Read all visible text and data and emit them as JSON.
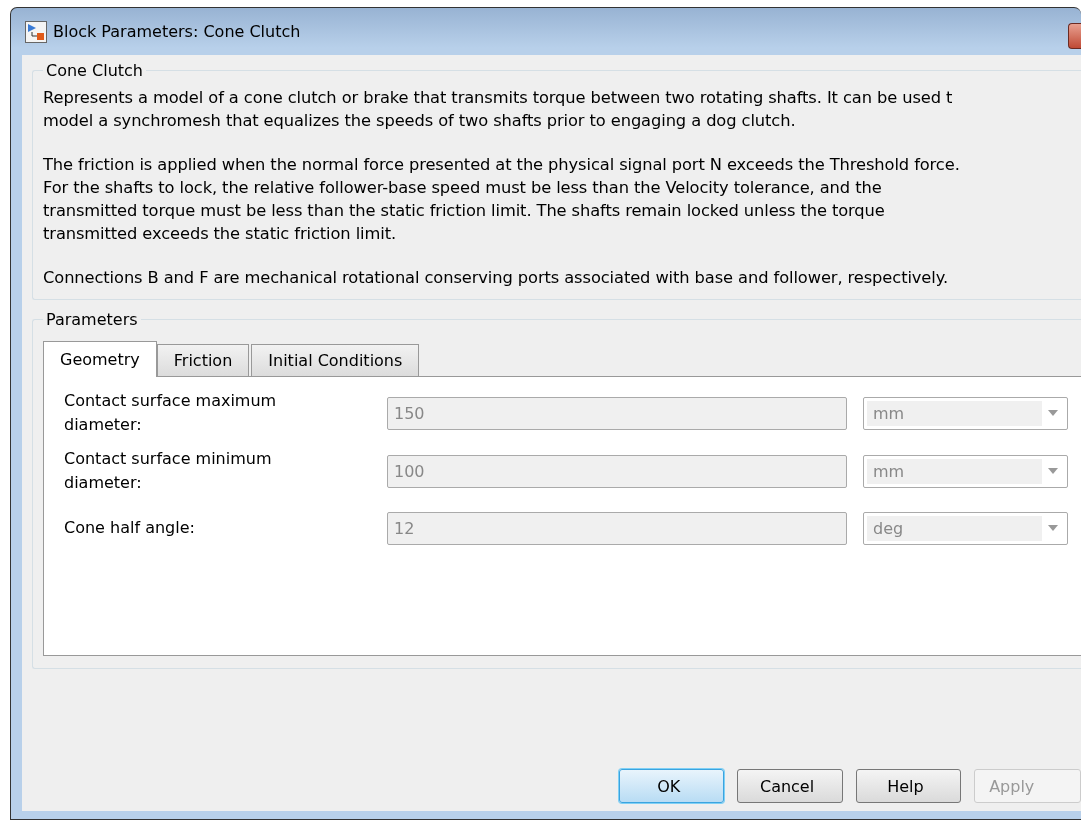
{
  "window": {
    "title": "Block Parameters: Cone Clutch"
  },
  "description": {
    "title": "Cone Clutch",
    "paragraphs": [
      [
        "Represents a model of a cone clutch or brake that transmits torque between two rotating shafts. It can be used t",
        "model a synchromesh that equalizes the speeds of two shafts prior to engaging a dog clutch."
      ],
      [
        "The friction is applied when the normal force presented at the physical signal port N exceeds the Threshold force.",
        "For the shafts to lock, the relative follower-base speed must be less than the Velocity tolerance, and the",
        "transmitted torque must be less than the static friction limit. The shafts remain locked unless the torque",
        "transmitted exceeds the static friction limit."
      ],
      [
        "Connections B and F are mechanical rotational conserving ports associated with base and follower, respectively."
      ]
    ]
  },
  "parameters": {
    "title": "Parameters",
    "tabs": [
      {
        "label": "Geometry",
        "selected": true
      },
      {
        "label": "Friction",
        "selected": false
      },
      {
        "label": "Initial Conditions",
        "selected": false
      }
    ],
    "rows": [
      {
        "label": "Contact surface maximum diameter:",
        "value": "150",
        "unit": "mm",
        "disabled": true
      },
      {
        "label": "Contact surface minimum diameter:",
        "value": "100",
        "unit": "mm",
        "disabled": true
      },
      {
        "label": "Cone half angle:",
        "value": "12",
        "unit": "deg",
        "disabled": true
      }
    ]
  },
  "buttons": [
    {
      "label": "OK",
      "default": true,
      "disabled": false
    },
    {
      "label": "Cancel",
      "default": false,
      "disabled": false
    },
    {
      "label": "Help",
      "default": false,
      "disabled": false
    },
    {
      "label": "Apply",
      "default": false,
      "disabled": true
    }
  ]
}
